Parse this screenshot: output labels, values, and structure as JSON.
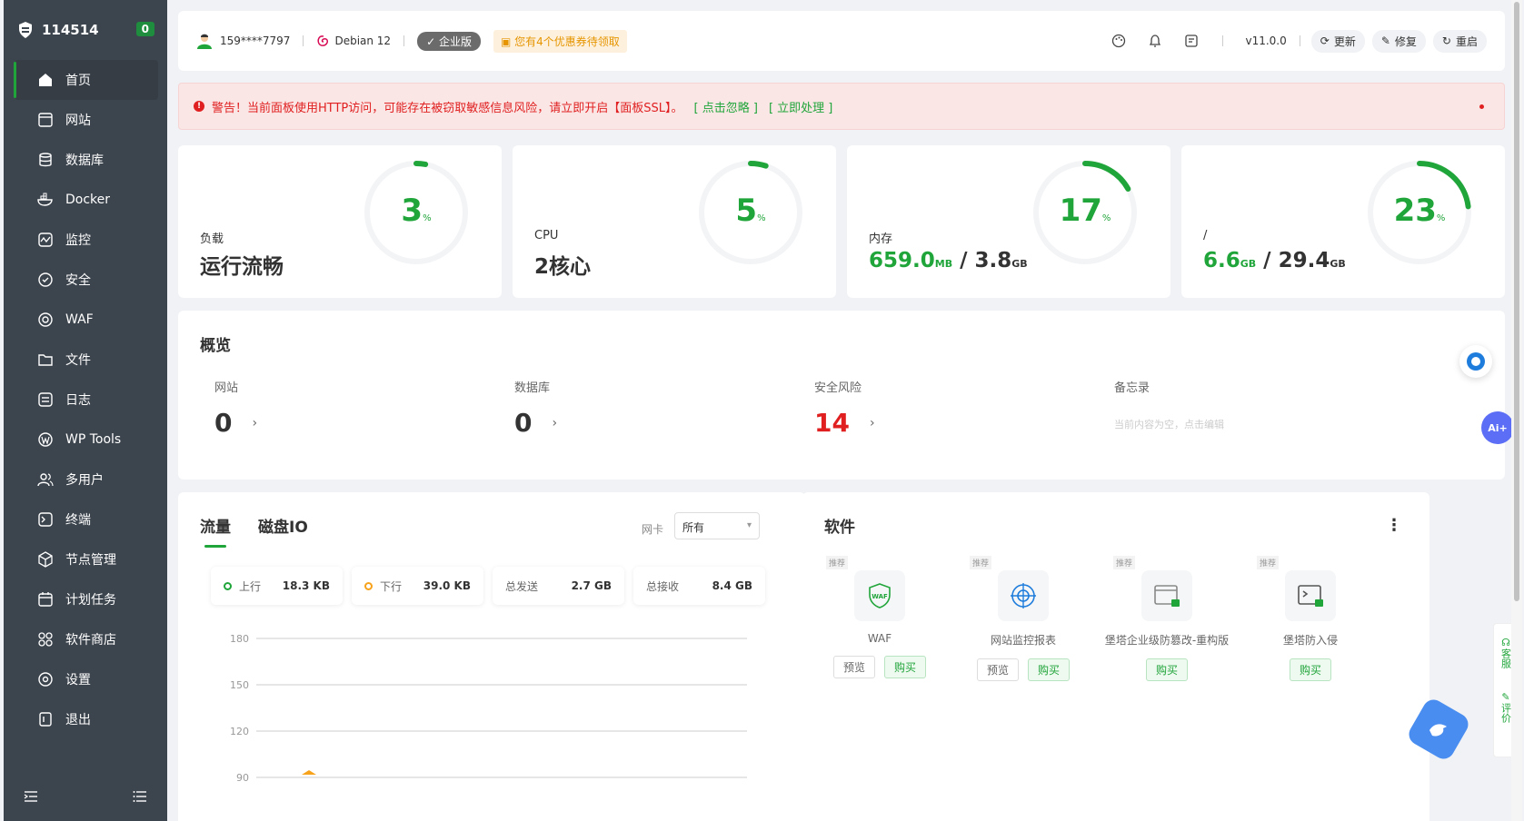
{
  "sidebar": {
    "title": "114514",
    "badge": "0",
    "items": [
      {
        "label": "首页",
        "icon": "home-icon"
      },
      {
        "label": "网站",
        "icon": "website-icon"
      },
      {
        "label": "数据库",
        "icon": "database-icon"
      },
      {
        "label": "Docker",
        "icon": "docker-icon"
      },
      {
        "label": "监控",
        "icon": "monitor-icon"
      },
      {
        "label": "安全",
        "icon": "shield-icon"
      },
      {
        "label": "WAF",
        "icon": "waf-icon"
      },
      {
        "label": "文件",
        "icon": "folder-icon"
      },
      {
        "label": "日志",
        "icon": "log-icon"
      },
      {
        "label": "WP Tools",
        "icon": "wordpress-icon"
      },
      {
        "label": "多用户",
        "icon": "users-icon"
      },
      {
        "label": "终端",
        "icon": "terminal-icon"
      },
      {
        "label": "节点管理",
        "icon": "node-icon"
      },
      {
        "label": "计划任务",
        "icon": "calendar-icon"
      },
      {
        "label": "软件商店",
        "icon": "store-icon"
      },
      {
        "label": "设置",
        "icon": "settings-icon"
      },
      {
        "label": "退出",
        "icon": "logout-icon"
      }
    ]
  },
  "topbar": {
    "user": "159****7797",
    "os": "Debian 12",
    "edition": "企业版",
    "coupon": "您有4个优惠券待领取",
    "version": "v11.0.0",
    "btn_update": "更新",
    "btn_repair": "修复",
    "btn_restart": "重启"
  },
  "alert": {
    "text": "警告！当前面板使用HTTP访问，可能存在被窃取敏感信息风险，请立即开启【面板SSL】。",
    "ignore": "[ 点击忽略 ]",
    "handle": "[ 立即处理 ]"
  },
  "stats": [
    {
      "label": "负载",
      "value": "运行流畅",
      "percent": "3",
      "percent_num": 3
    },
    {
      "label": "CPU",
      "value": "2核心",
      "percent": "5",
      "percent_num": 5
    },
    {
      "label": "内存",
      "used": "659.0",
      "used_unit": "MB",
      "total": "3.8",
      "total_unit": "GB",
      "percent": "17",
      "percent_num": 17
    },
    {
      "label": "/",
      "used": "6.6",
      "used_unit": "GB",
      "total": "29.4",
      "total_unit": "GB",
      "percent": "23",
      "percent_num": 23
    }
  ],
  "percent_sign": "%",
  "overview": {
    "title": "概览",
    "website_label": "网站",
    "website_value": "0",
    "db_label": "数据库",
    "db_value": "0",
    "risk_label": "安全风险",
    "risk_value": "14",
    "memo_label": "备忘录",
    "memo_text": "当前内容为空，点击编辑"
  },
  "traffic": {
    "tab_traffic": "流量",
    "tab_disk": "磁盘IO",
    "nic_label": "网卡",
    "nic_value": "所有",
    "up_label": "上行",
    "up_value": "18.3 KB",
    "down_label": "下行",
    "down_value": "39.0 KB",
    "sent_label": "总发送",
    "sent_value": "2.7 GB",
    "recv_label": "总接收",
    "recv_value": "8.4 GB",
    "y_ticks": [
      "180",
      "150",
      "120",
      "90"
    ]
  },
  "software": {
    "title": "软件",
    "items": [
      {
        "tag": "推荐",
        "name": "WAF",
        "preview": "预览",
        "buy": "购买"
      },
      {
        "tag": "推荐",
        "name": "网站监控报表",
        "preview": "预览",
        "buy": "购买"
      },
      {
        "tag": "推荐",
        "name": "堡塔企业级防篡改-重构版",
        "buy": "购买"
      },
      {
        "tag": "推荐",
        "name": "堡塔防入侵",
        "buy": "购买"
      }
    ]
  },
  "side_widget": {
    "service": "客服",
    "rate": "评价"
  },
  "ai_label": "Ai+",
  "colors": {
    "accent": "#20a53a",
    "sidebar": "#3c444d",
    "danger": "#e02020"
  }
}
